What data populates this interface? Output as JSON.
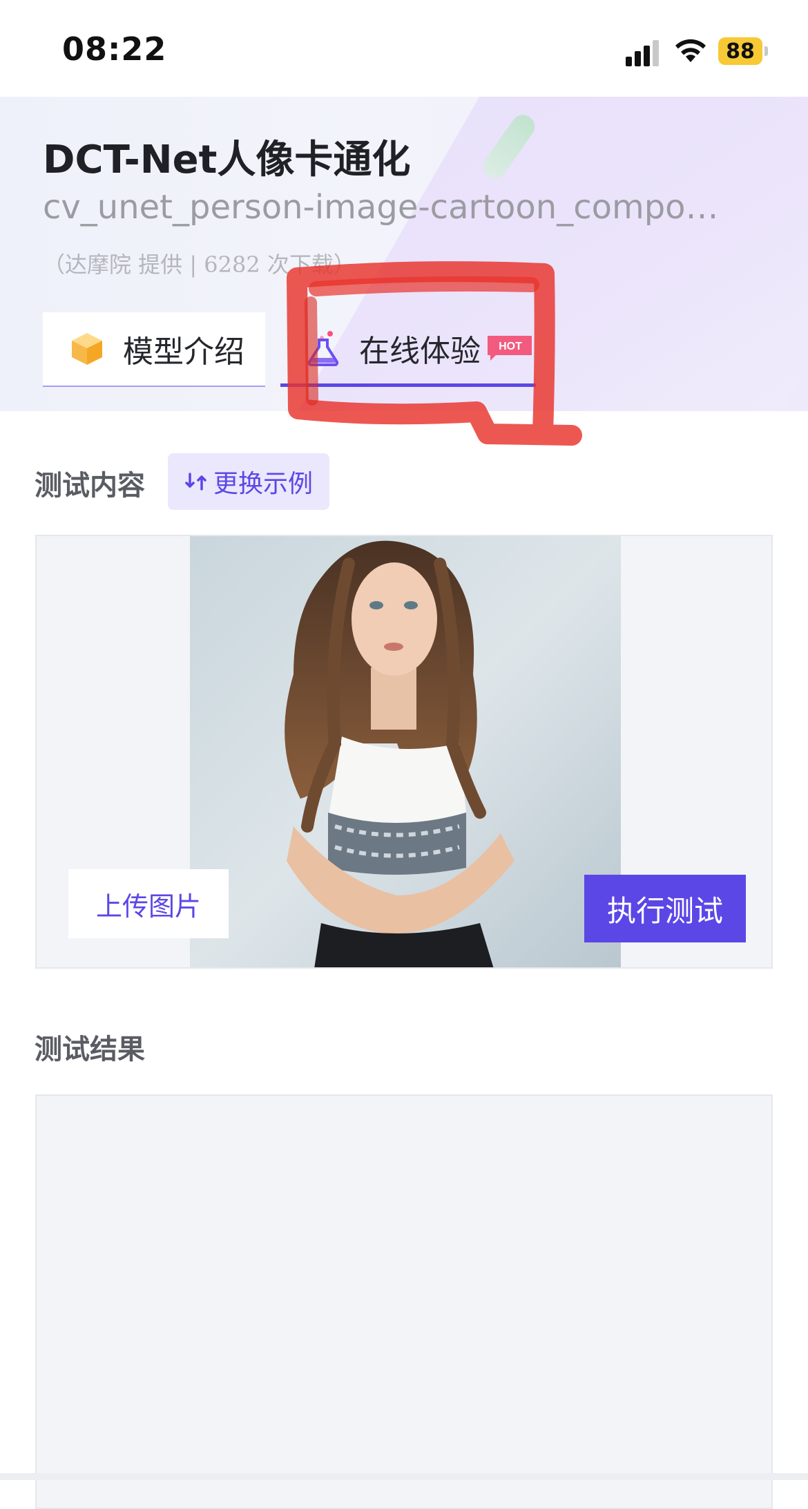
{
  "status_bar": {
    "time": "08:22",
    "battery_level": "88",
    "signal_icon": "cellular-signal-icon",
    "wifi_icon": "wifi-icon"
  },
  "header": {
    "title": "DCT-Net人像卡通化",
    "model_id": "cv_unet_person-image-cartoon_compound-models",
    "meta": "（达摩院  提供   |   6282 次下载）"
  },
  "tabs": [
    {
      "label": "模型介绍",
      "icon": "cube-icon",
      "active": false
    },
    {
      "label": "在线体验",
      "icon": "flask-icon",
      "badge": "HOT",
      "active": true
    }
  ],
  "test": {
    "section_title": "测试内容",
    "swap_label": "更换示例",
    "swap_icon": "swap-arrows-icon",
    "photo_description_icon": "portrait-photo",
    "upload_label": "上传图片",
    "run_label": "执行测试"
  },
  "result": {
    "section_title": "测试结果"
  },
  "colors": {
    "accent": "#5b47e6",
    "accent_light": "#ebe7fd",
    "panel_bg": "#f3f4f8",
    "annotation_red": "#e8332b"
  }
}
